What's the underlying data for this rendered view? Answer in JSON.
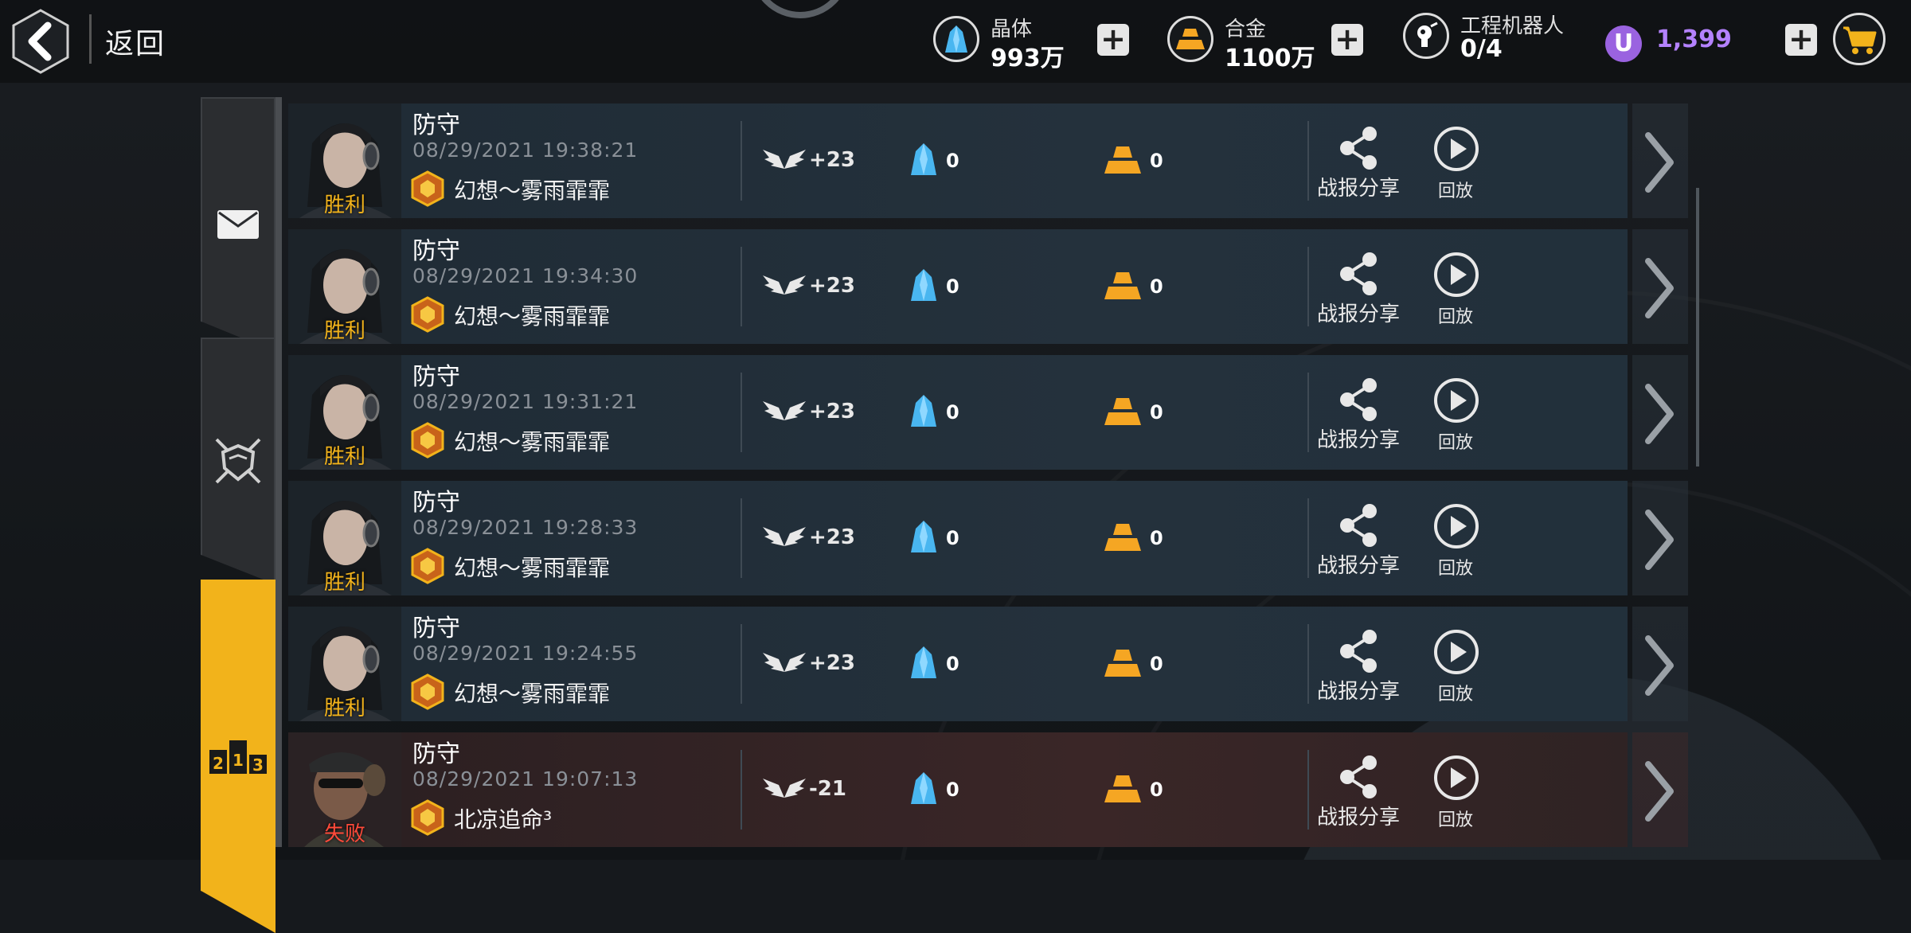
{
  "header": {
    "back_label": "返回",
    "resources": [
      {
        "name": "晶体",
        "value": "993万"
      },
      {
        "name": "合金",
        "value": "1100万"
      },
      {
        "name": "工程机器人",
        "value": "0/4"
      }
    ],
    "premium": {
      "symbol": "U",
      "value": "1,399"
    }
  },
  "colors": {
    "crystal": "#49b6f0",
    "gold": "#f5a623",
    "victory": "#f2b31b",
    "defeat": "#ff4a3a",
    "premium": "#b482ff"
  },
  "side_tabs": [
    {
      "icon": "mail-icon",
      "active": false
    },
    {
      "icon": "crossed-swords-shield-icon",
      "active": false
    },
    {
      "icon": "ranking-podium-icon",
      "active": true,
      "label": "213"
    }
  ],
  "battles": [
    {
      "result": "胜利",
      "mode": "防守",
      "time": "08/29/2021 19:38:21",
      "opponent": "幻想～雾雨霏霏",
      "medal_delta": "+23",
      "crystal": "0",
      "alloy": "0",
      "share_label": "战报分享",
      "replay_label": "回放",
      "outcome": "victory"
    },
    {
      "result": "胜利",
      "mode": "防守",
      "time": "08/29/2021 19:34:30",
      "opponent": "幻想～雾雨霏霏",
      "medal_delta": "+23",
      "crystal": "0",
      "alloy": "0",
      "share_label": "战报分享",
      "replay_label": "回放",
      "outcome": "victory"
    },
    {
      "result": "胜利",
      "mode": "防守",
      "time": "08/29/2021 19:31:21",
      "opponent": "幻想～雾雨霏霏",
      "medal_delta": "+23",
      "crystal": "0",
      "alloy": "0",
      "share_label": "战报分享",
      "replay_label": "回放",
      "outcome": "victory"
    },
    {
      "result": "胜利",
      "mode": "防守",
      "time": "08/29/2021 19:28:33",
      "opponent": "幻想～雾雨霏霏",
      "medal_delta": "+23",
      "crystal": "0",
      "alloy": "0",
      "share_label": "战报分享",
      "replay_label": "回放",
      "outcome": "victory"
    },
    {
      "result": "胜利",
      "mode": "防守",
      "time": "08/29/2021 19:24:55",
      "opponent": "幻想～雾雨霏霏",
      "medal_delta": "+23",
      "crystal": "0",
      "alloy": "0",
      "share_label": "战报分享",
      "replay_label": "回放",
      "outcome": "victory"
    },
    {
      "result": "失败",
      "mode": "防守",
      "time": "08/29/2021 19:07:13",
      "opponent": "北凉追命³",
      "medal_delta": "-21",
      "crystal": "0",
      "alloy": "0",
      "share_label": "战报分享",
      "replay_label": "回放",
      "outcome": "defeat"
    }
  ]
}
